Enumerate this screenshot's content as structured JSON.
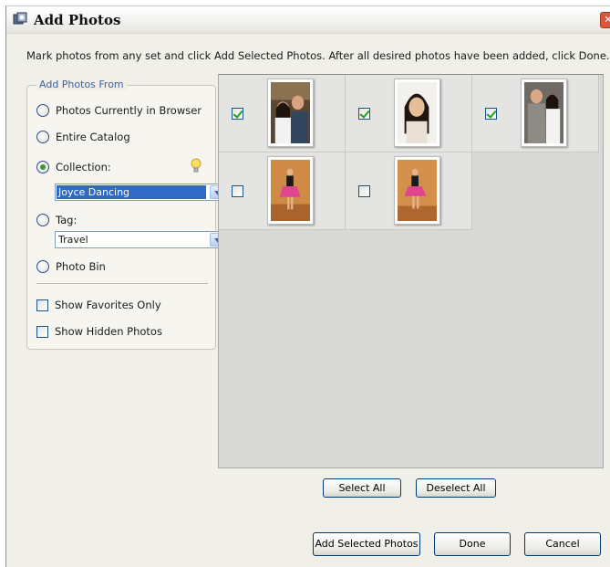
{
  "window": {
    "title": "Add Photos",
    "instructions": "Mark photos from any set and click Add Selected Photos. After all desired photos have been added, click Done."
  },
  "add_from": {
    "legend": "Add Photos From",
    "options": {
      "browser": "Photos Currently in Browser",
      "catalog": "Entire Catalog",
      "collection": "Collection:",
      "tag": "Tag:",
      "bin": "Photo Bin"
    },
    "selected_option": "collection",
    "collection_value": "Joyce Dancing",
    "tag_value": "Travel",
    "show_favorites_label": "Show Favorites Only",
    "show_hidden_label": "Show Hidden Photos",
    "show_favorites_checked": false,
    "show_hidden_checked": false
  },
  "photos": [
    {
      "checked": true,
      "subject": "couple-smiling-photo"
    },
    {
      "checked": true,
      "subject": "woman-portrait-photo"
    },
    {
      "checked": true,
      "subject": "couple-standing-photo"
    },
    {
      "checked": false,
      "subject": "dancer-pink-skirt-photo"
    },
    {
      "checked": false,
      "subject": "dancer-pink-skirt-photo"
    }
  ],
  "buttons": {
    "select_all": "Select All",
    "deselect_all": "Deselect All",
    "add_selected": "Add Selected Photos",
    "done": "Done",
    "cancel": "Cancel"
  },
  "colors": {
    "accent_blue": "#316ac5",
    "legend_blue": "#3b5fa6",
    "radio_dot_green": "#3a9a31",
    "check_green": "#21a121"
  }
}
